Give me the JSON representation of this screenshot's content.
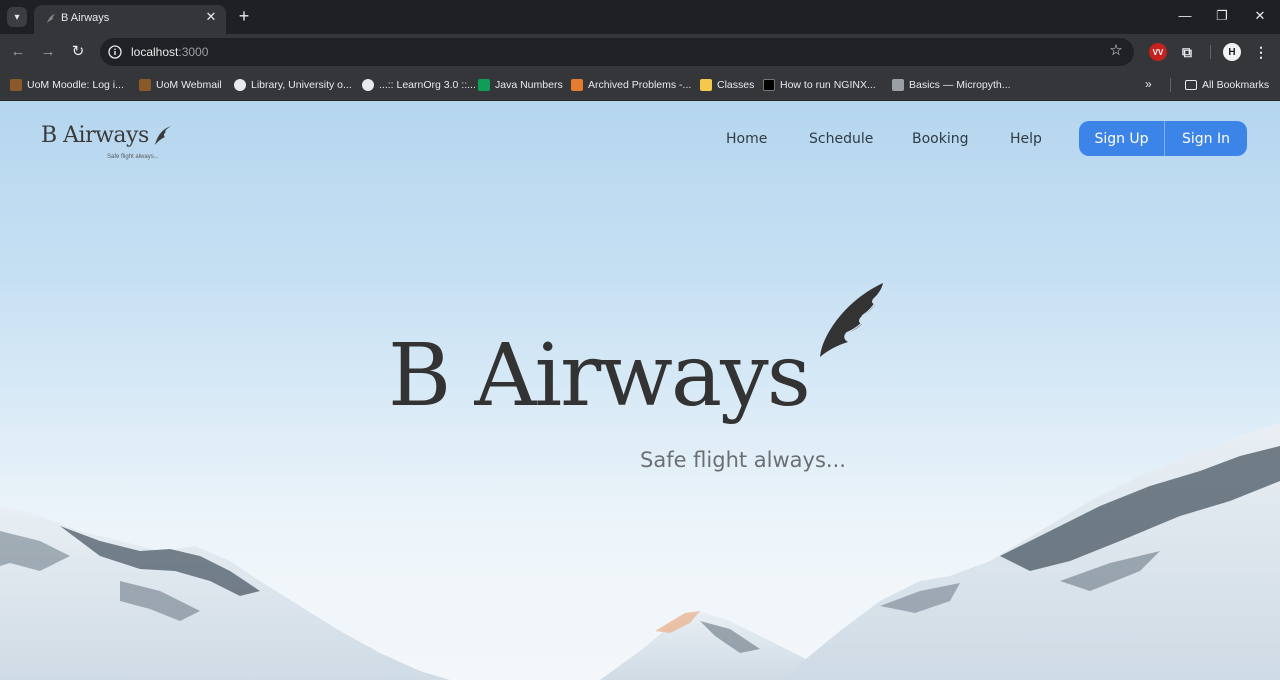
{
  "browser": {
    "tab": {
      "title": "B Airways"
    },
    "address": {
      "host": "localhost",
      "port": ":3000"
    },
    "bookmarks": [
      {
        "label": "UoM Moodle: Log i...",
        "icon_color": "#8a5a2b"
      },
      {
        "label": "UoM Webmail",
        "icon_color": "#8a5a2b"
      },
      {
        "label": "Library, University o...",
        "icon_color": "#e8eaed"
      },
      {
        "label": "...:: LearnOrg 3.0 ::...",
        "icon_color": "#e8eaed"
      },
      {
        "label": "Java Numbers",
        "icon_color": "#0f9d58"
      },
      {
        "label": "Archived Problems -...",
        "icon_color": "#e67c2f"
      },
      {
        "label": "Classes",
        "icon_color": "#f2c94c"
      },
      {
        "label": "How to run NGINX...",
        "icon_color": "#000000"
      },
      {
        "label": "Basics — Micropyth...",
        "icon_color": "#9aa0a6"
      }
    ],
    "all_bookmarks": "All Bookmarks",
    "ext_vv": "VV",
    "ext_h": "H"
  },
  "site": {
    "logo": {
      "name": "B Airways",
      "tagline": "Safe flight always..."
    },
    "nav": {
      "home": "Home",
      "schedule": "Schedule",
      "booking": "Booking",
      "help": "Help"
    },
    "auth": {
      "sign_up": "Sign Up",
      "sign_in": "Sign In"
    },
    "hero": {
      "title": "B Airways",
      "tagline": "Safe flight always..."
    }
  },
  "colors": {
    "accent": "#3d84e8",
    "text_dark": "#333333",
    "sky_top": "#b5d6ef"
  }
}
